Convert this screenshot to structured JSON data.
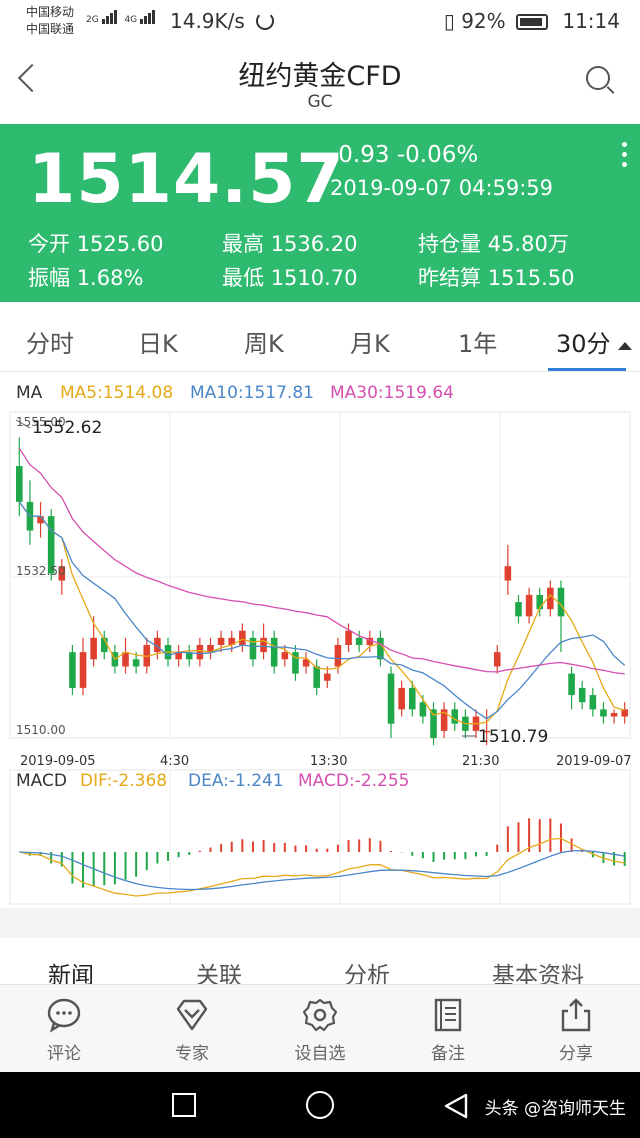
{
  "status_bar": {
    "carrier1": "中国移动",
    "carrier2": "中国联通",
    "net1": "2G",
    "net2": "4G",
    "speed": "14.9K/s",
    "battery": "92%",
    "time": "11:14"
  },
  "header": {
    "title": "纽约黄金CFD",
    "subtitle": "GC"
  },
  "quote": {
    "price": "1514.57",
    "change": "-0.93 -0.06%",
    "datetime": "2019-09-07 04:59:59",
    "stats": [
      {
        "label": "今开",
        "value": "1525.60"
      },
      {
        "label": "最高",
        "value": "1536.20"
      },
      {
        "label": "持仓量",
        "value": "45.80万"
      },
      {
        "label": "振幅",
        "value": "1.68%"
      },
      {
        "label": "最低",
        "value": "1510.70"
      },
      {
        "label": "昨结算",
        "value": "1515.50"
      }
    ],
    "bg_color": "#2fbb6f"
  },
  "tabs": [
    "分时",
    "日K",
    "周K",
    "月K",
    "1年",
    "30分"
  ],
  "active_tab": "30分",
  "chart_data": {
    "type": "candlestick",
    "ma_legend": {
      "label": "MA",
      "ma5": "MA5:1514.08",
      "ma10": "MA10:1517.81",
      "ma30": "MA30:1519.64"
    },
    "y_ticks": [
      "1555.00",
      "1532.50",
      "1510.00"
    ],
    "ylim": [
      1510,
      1555
    ],
    "x_ticks": [
      "2019-09-05",
      "4:30",
      "13:30",
      "21:30",
      "2019-09-07"
    ],
    "high_label": "1552.62",
    "low_label": "1510.79",
    "colors": {
      "up": "#e0402f",
      "down": "#1fa849",
      "ma5": "#e6a817",
      "ma10": "#4a86c8",
      "ma30": "#d64fb0"
    },
    "candles": [
      [
        1548,
        1543,
        1552,
        1541
      ],
      [
        1543,
        1539,
        1546,
        1537
      ],
      [
        1540,
        1541,
        1543,
        1538
      ],
      [
        1541,
        1533,
        1542,
        1532
      ],
      [
        1532,
        1534,
        1535,
        1530
      ],
      [
        1522,
        1517,
        1523,
        1516
      ],
      [
        1517,
        1522,
        1524,
        1516
      ],
      [
        1521,
        1524,
        1527,
        1520
      ],
      [
        1524,
        1522,
        1525,
        1521
      ],
      [
        1522,
        1520,
        1523,
        1519
      ],
      [
        1520,
        1522,
        1524,
        1519
      ],
      [
        1521,
        1520,
        1522,
        1519
      ],
      [
        1520,
        1523,
        1524,
        1519
      ],
      [
        1522,
        1524,
        1525,
        1521
      ],
      [
        1523,
        1521,
        1524,
        1520
      ],
      [
        1521,
        1522,
        1523,
        1520
      ],
      [
        1522,
        1521,
        1523,
        1520
      ],
      [
        1521,
        1523,
        1524,
        1520
      ],
      [
        1522,
        1523,
        1524,
        1521
      ],
      [
        1523,
        1524,
        1525,
        1522
      ],
      [
        1523,
        1524,
        1525,
        1522
      ],
      [
        1523,
        1525,
        1526,
        1522
      ],
      [
        1524,
        1521,
        1525,
        1520
      ],
      [
        1522,
        1524,
        1526,
        1521
      ],
      [
        1524,
        1520,
        1525,
        1519
      ],
      [
        1521,
        1522,
        1523,
        1520
      ],
      [
        1522,
        1519,
        1523,
        1518
      ],
      [
        1520,
        1521,
        1522,
        1519
      ],
      [
        1520,
        1517,
        1521,
        1516
      ],
      [
        1518,
        1519,
        1520,
        1517
      ],
      [
        1520,
        1523,
        1524,
        1519
      ],
      [
        1523,
        1525,
        1526,
        1522
      ],
      [
        1524,
        1523,
        1525,
        1522
      ],
      [
        1523,
        1524,
        1525,
        1522
      ],
      [
        1524,
        1521,
        1525,
        1520
      ],
      [
        1519,
        1512,
        1520,
        1510
      ],
      [
        1514,
        1517,
        1518,
        1513
      ],
      [
        1517,
        1514,
        1518,
        1513
      ],
      [
        1515,
        1513,
        1516,
        1512
      ],
      [
        1514,
        1510,
        1515,
        1509
      ],
      [
        1511,
        1514,
        1515,
        1510
      ],
      [
        1514,
        1512,
        1515,
        1511
      ],
      [
        1513,
        1511,
        1514,
        1510
      ],
      [
        1511,
        1513,
        1514,
        1510
      ],
      [
        1511,
        1511,
        1514,
        1509
      ],
      [
        1520,
        1522,
        1523,
        1519
      ],
      [
        1532,
        1534,
        1537,
        1530
      ],
      [
        1529,
        1527,
        1530,
        1526
      ],
      [
        1527,
        1530,
        1531,
        1526
      ],
      [
        1530,
        1528,
        1531,
        1527
      ],
      [
        1528,
        1531,
        1532,
        1527
      ],
      [
        1531,
        1527,
        1532,
        1522
      ],
      [
        1519,
        1516,
        1520,
        1514
      ],
      [
        1517,
        1515,
        1518,
        1514
      ],
      [
        1516,
        1514,
        1517,
        1513
      ],
      [
        1514,
        1513,
        1515,
        1512
      ],
      [
        1513,
        1513.5,
        1514,
        1512
      ],
      [
        1513,
        1514,
        1515,
        1512
      ]
    ],
    "macd_legend": {
      "label": "MACD",
      "dif": "DIF:-2.368",
      "dea": "DEA:-1.241",
      "macd": "MACD:-2.255"
    }
  },
  "subtabs": [
    "新闻",
    "关联",
    "分析",
    "基本资料"
  ],
  "bottom_nav": [
    {
      "label": "评论",
      "icon": "comment-icon"
    },
    {
      "label": "专家",
      "icon": "diamond-icon"
    },
    {
      "label": "设自选",
      "icon": "gear-icon"
    },
    {
      "label": "备注",
      "icon": "note-icon"
    },
    {
      "label": "分享",
      "icon": "share-icon"
    }
  ],
  "watermark": "头条 @咨询师天生"
}
